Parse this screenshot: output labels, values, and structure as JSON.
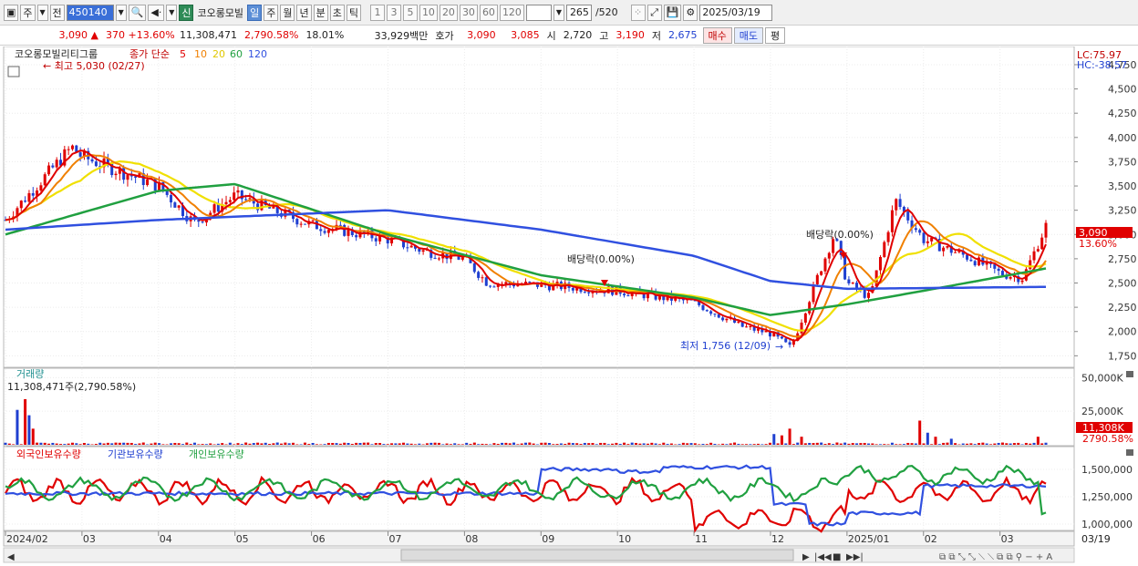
{
  "toolbar": {
    "market": "주",
    "type": "전",
    "code": "450140",
    "badge": "신",
    "name": "코오롱모빌",
    "periods": [
      "일",
      "주",
      "월",
      "년",
      "분",
      "초",
      "틱"
    ],
    "intervals": [
      "1",
      "3",
      "5",
      "10",
      "20",
      "30",
      "60",
      "120"
    ],
    "count": "265",
    "total": "/520",
    "date": "2025/03/19"
  },
  "quote": {
    "price": "3,090",
    "change": "370",
    "change_pct": "+13.60%",
    "volume": "11,308,471",
    "vol_pct": "2,790.58%",
    "turnover": "18.01%",
    "amount": "33,929백만",
    "ask_label": "호가",
    "ask1": "3,090",
    "ask2": "3,085",
    "open_label": "시",
    "open": "2,720",
    "high_label": "고",
    "high": "3,190",
    "low_label": "저",
    "low": "2,675",
    "buy": "매수",
    "sell": "매도",
    "avg": "평"
  },
  "price_panel": {
    "name": "코오롱모빌리티그룹",
    "ma_label": "종가 단순",
    "ma_periods": [
      "5",
      "10",
      "20",
      "60",
      "120"
    ],
    "high_note": "최고 5,030 (02/27)",
    "low_note": "최저 1,756 (12/09)",
    "div1": "배당락(0.00%)",
    "div2": "배당락(0.00%)",
    "lc": "LC:75.97",
    "hc": "HC:-38.57",
    "price_tag": "3,090",
    "pct_tag": "13.60%",
    "y_ticks": [
      "4,750",
      "4,500",
      "4,250",
      "4,000",
      "3,750",
      "3,500",
      "3,250",
      "3,000",
      "2,750",
      "2,500",
      "2,250",
      "2,000",
      "1,750"
    ]
  },
  "volume_panel": {
    "title": "거래량",
    "value": "11,308,471주(2,790.58%)",
    "y_ticks": [
      "50,000K",
      "25,000K"
    ],
    "tag1": "11,308K",
    "tag2": "2790.58%"
  },
  "holder_panel": {
    "foreign": "외국인보유수량",
    "inst": "기관보유수량",
    "indiv": "개인보유수량",
    "y_ticks": [
      "1,500,000",
      "1,250,000",
      "1,000,000"
    ]
  },
  "x_axis": {
    "labels": [
      "2024/02",
      "03",
      "04",
      "05",
      "06",
      "07",
      "08",
      "09",
      "10",
      "11",
      "12",
      "2025/01",
      "02",
      "03"
    ],
    "end": "03/19"
  },
  "colors": {
    "ma5": "#e00000",
    "ma10": "#f08000",
    "ma20": "#f0e000",
    "ma60": "#20a040",
    "ma120": "#3050e0",
    "up": "#e00000",
    "down": "#1f3fd0"
  },
  "chart_data": {
    "type": "line",
    "price_series": [
      {
        "date": "2024/02",
        "close": 3150
      },
      {
        "date": "2024/02/27",
        "close": 3900
      },
      {
        "date": "2024/03",
        "close": 3800
      },
      {
        "date": "2024/04",
        "close": 3500
      },
      {
        "date": "2024/04/15",
        "close": 3120
      },
      {
        "date": "2024/05",
        "close": 3400
      },
      {
        "date": "2024/06",
        "close": 3100
      },
      {
        "date": "2024/07",
        "close": 2950
      },
      {
        "date": "2024/07/15",
        "close": 2830
      },
      {
        "date": "2024/08",
        "close": 2750
      },
      {
        "date": "2024/08/10",
        "close": 2500
      },
      {
        "date": "2024/09",
        "close": 2480
      },
      {
        "date": "2024/10",
        "close": 2420
      },
      {
        "date": "2024/11",
        "close": 2300
      },
      {
        "date": "2024/11/20",
        "close": 2050
      },
      {
        "date": "2024/12",
        "close": 1980
      },
      {
        "date": "2024/12/09",
        "close": 1830
      },
      {
        "date": "2024/12/20",
        "close": 2600
      },
      {
        "date": "2024/12/26",
        "close": 3000
      },
      {
        "date": "2025/01",
        "close": 2500
      },
      {
        "date": "2025/01/10",
        "close": 2350
      },
      {
        "date": "2025/01/20",
        "close": 3350
      },
      {
        "date": "2025/02",
        "close": 2950
      },
      {
        "date": "2025/02/20",
        "close": 2750
      },
      {
        "date": "2025/03",
        "close": 2600
      },
      {
        "date": "2025/03/10",
        "close": 2550
      },
      {
        "date": "2025/03/19",
        "close": 3090
      }
    ],
    "ma120": [
      {
        "date": "2024/02",
        "value": 3050
      },
      {
        "date": "2024/04",
        "value": 3150
      },
      {
        "date": "2024/07",
        "value": 3250
      },
      {
        "date": "2024/09",
        "value": 3050
      },
      {
        "date": "2024/11",
        "value": 2780
      },
      {
        "date": "2024/12",
        "value": 2520
      },
      {
        "date": "2025/01",
        "value": 2440
      },
      {
        "date": "2025/03/19",
        "value": 2460
      }
    ],
    "ma60": [
      {
        "date": "2024/02",
        "value": 3000
      },
      {
        "date": "2024/04",
        "value": 3450
      },
      {
        "date": "2024/05",
        "value": 3520
      },
      {
        "date": "2024/07",
        "value": 3000
      },
      {
        "date": "2024/09",
        "value": 2580
      },
      {
        "date": "2024/11",
        "value": 2350
      },
      {
        "date": "2024/12",
        "value": 2170
      },
      {
        "date": "2025/01",
        "value": 2280
      },
      {
        "date": "2025/02",
        "value": 2420
      },
      {
        "date": "2025/03/19",
        "value": 2650
      }
    ],
    "ylim": [
      1650,
      4900
    ],
    "volume_ylim": [
      0,
      55000
    ]
  }
}
